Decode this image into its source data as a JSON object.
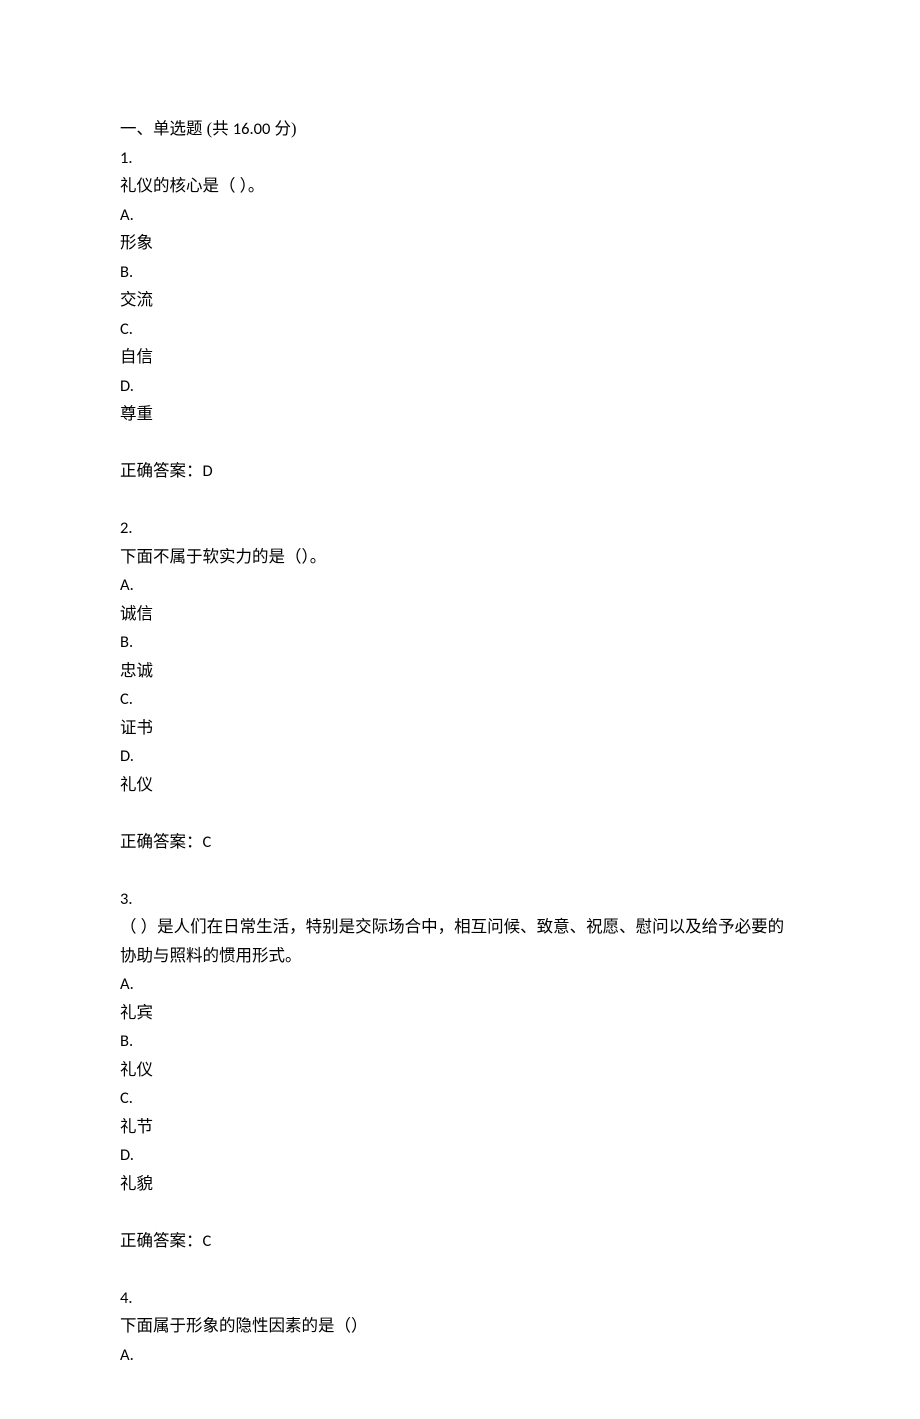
{
  "section": {
    "title_prefix": "一、单选题 (共 ",
    "points": "16.00",
    "title_suffix": " 分)"
  },
  "questions": [
    {
      "num": "1.",
      "text": "礼仪的核心是（ ）。",
      "options": [
        {
          "label": "A.",
          "text": "形象"
        },
        {
          "label": "B.",
          "text": "交流"
        },
        {
          "label": "C.",
          "text": "自信"
        },
        {
          "label": "D.",
          "text": "尊重"
        }
      ],
      "answer_label": "正确答案：",
      "answer_value": "D"
    },
    {
      "num": "2.",
      "text": "下面不属于软实力的是（）。",
      "options": [
        {
          "label": "A.",
          "text": "诚信"
        },
        {
          "label": "B.",
          "text": "忠诚"
        },
        {
          "label": "C.",
          "text": "证书"
        },
        {
          "label": "D.",
          "text": "礼仪"
        }
      ],
      "answer_label": "正确答案：",
      "answer_value": "C"
    },
    {
      "num": "3.",
      "text": "（  ）是人们在日常生活，特别是交际场合中，相互问候、致意、祝愿、慰问以及给予必要的协助与照料的惯用形式。",
      "options": [
        {
          "label": "A.",
          "text": "礼宾"
        },
        {
          "label": "B.",
          "text": "礼仪"
        },
        {
          "label": "C.",
          "text": "礼节"
        },
        {
          "label": "D.",
          "text": "礼貌"
        }
      ],
      "answer_label": "正确答案：",
      "answer_value": "C"
    },
    {
      "num": "4.",
      "text": "下面属于形象的隐性因素的是（）",
      "options": [
        {
          "label": "A.",
          "text": ""
        }
      ],
      "answer_label": "",
      "answer_value": ""
    }
  ]
}
